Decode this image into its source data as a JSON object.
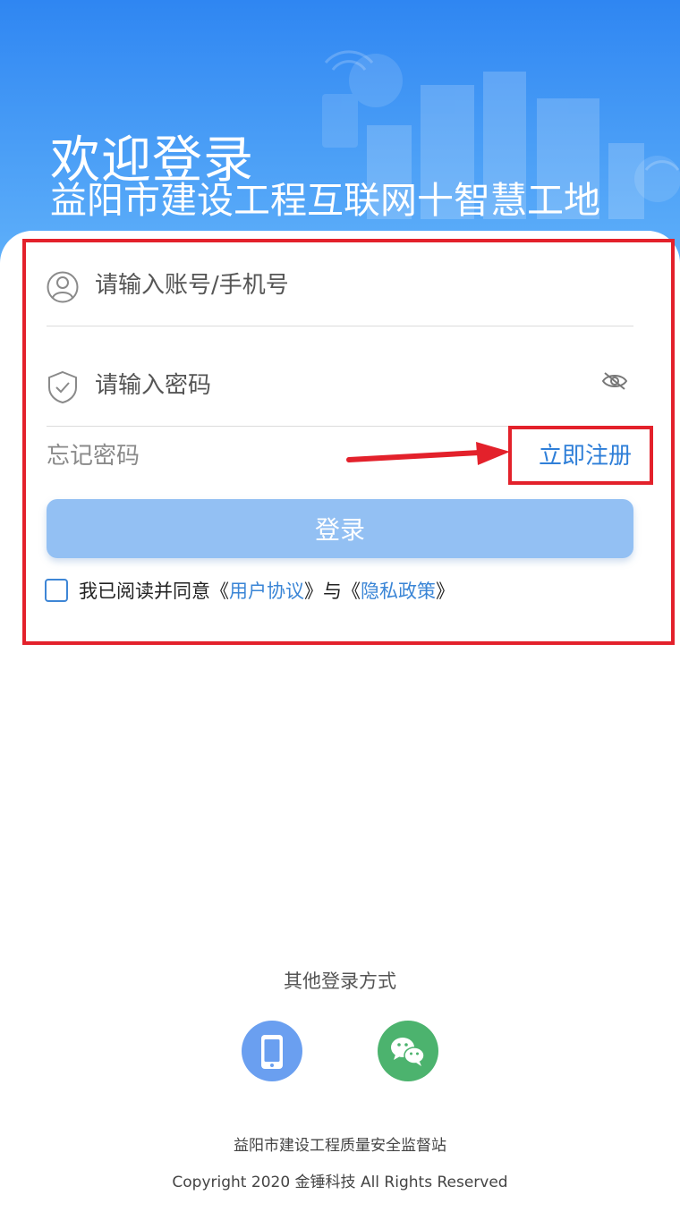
{
  "header": {
    "title": "欢迎登录",
    "subtitle": "益阳市建设工程互联网十智慧工地"
  },
  "form": {
    "account_placeholder": "请输入账号/手机号",
    "password_placeholder": "请输入密码",
    "forgot_password": "忘记密码",
    "register": "立即注册",
    "login_button": "登录",
    "agreement": {
      "prefix": "我已阅读并同意《",
      "user_agreement": "用户协议",
      "middle": "》与《",
      "privacy_policy": "隐私政策",
      "suffix": "》",
      "checked": false
    }
  },
  "other_login": {
    "title": "其他登录方式",
    "methods": [
      {
        "name": "phone",
        "icon": "phone-icon",
        "color": "#6a9ff0"
      },
      {
        "name": "wechat",
        "icon": "wechat-icon",
        "color": "#4cb36e"
      }
    ]
  },
  "footer": {
    "org": "益阳市建设工程质量安全监督站",
    "copyright": "Copyright 2020 金锤科技 All Rights Reserved"
  },
  "colors": {
    "primary": "#2f86f2",
    "link": "#2f7fd8",
    "login_button": "#93c0f3",
    "annotation": "#e3212b"
  }
}
